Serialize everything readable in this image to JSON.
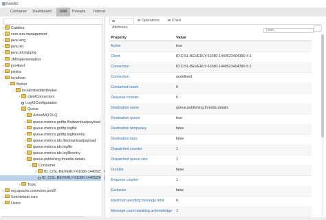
{
  "app": {
    "logo_text": "hawtio"
  },
  "nav": {
    "tabs": [
      "Container",
      "Dashboard",
      "JMX",
      "Threads",
      "Tomcat"
    ],
    "active": "JMX"
  },
  "tree": [
    {
      "label": "Catalina",
      "depth": 0,
      "toggle": "+",
      "icon": "folder"
    },
    {
      "label": "com.sun.management",
      "depth": 0,
      "toggle": "+",
      "icon": "folder"
    },
    {
      "label": "java.lang",
      "depth": 0,
      "toggle": "+",
      "icon": "folder"
    },
    {
      "label": "java.nio",
      "depth": 0,
      "toggle": "+",
      "icon": "folder"
    },
    {
      "label": "java.util.logging",
      "depth": 0,
      "toggle": "+",
      "icon": "folder"
    },
    {
      "label": "JMImplementation",
      "depth": 0,
      "toggle": "+",
      "icon": "folder"
    },
    {
      "label": "jmx4perl",
      "depth": 0,
      "toggle": "+",
      "icon": "folder"
    },
    {
      "label": "jolokia",
      "depth": 0,
      "toggle": "+",
      "icon": "folder"
    },
    {
      "label": "localhost",
      "depth": 0,
      "toggle": "−",
      "icon": "folder"
    },
    {
      "label": "Broker",
      "depth": 1,
      "toggle": "−",
      "icon": "folder"
    },
    {
      "label": "localembeddedbroker",
      "depth": 2,
      "toggle": "−",
      "icon": "folder"
    },
    {
      "label": "clientConnectors",
      "depth": 3,
      "toggle": "+",
      "icon": "folder"
    },
    {
      "label": "Log4JConfiguration",
      "depth": 3,
      "toggle": "",
      "icon": "gear"
    },
    {
      "label": "Queue",
      "depth": 3,
      "toggle": "−",
      "icon": "folder"
    },
    {
      "label": "ActiveMQ.DLQ",
      "depth": 4,
      "toggle": "+",
      "icon": "folder"
    },
    {
      "label": "queue.metrics.grdftp.filedownloadpayload",
      "depth": 4,
      "toggle": "+",
      "icon": "folder"
    },
    {
      "label": "queue.metrics.grdftp.logfile",
      "depth": 4,
      "toggle": "+",
      "icon": "folder"
    },
    {
      "label": "queue.metrics.grdftp.logfileentry",
      "depth": 4,
      "toggle": "+",
      "icon": "folder"
    },
    {
      "label": "queue.metrics.tds.filedownloadpayload",
      "depth": 4,
      "toggle": "+",
      "icon": "folder"
    },
    {
      "label": "queue.metrics.tds.logfile",
      "depth": 4,
      "toggle": "+",
      "icon": "folder"
    },
    {
      "label": "queue.metrics.tds.logfileentry",
      "depth": 4,
      "toggle": "+",
      "icon": "folder"
    },
    {
      "label": "queue.publishing.thredds.details",
      "depth": 4,
      "toggle": "−",
      "icon": "folder"
    },
    {
      "label": "Consumer",
      "depth": 5,
      "toggle": "−",
      "icon": "folder"
    },
    {
      "label": "ID_CISL-BEVERLY-61080-1440523404390-4:1",
      "depth": 6,
      "toggle": "+",
      "icon": "folder"
    },
    {
      "label": "ID_CISL-BEVERLY-61080-1440523404390-",
      "depth": 6,
      "toggle": "",
      "icon": "gear",
      "selected": true
    },
    {
      "label": "Topic",
      "depth": 3,
      "toggle": "+",
      "icon": "folder"
    },
    {
      "label": "org.apache.commons.pool2",
      "depth": 0,
      "toggle": "+",
      "icon": "folder"
    },
    {
      "label": "Solr/default-core",
      "depth": 0,
      "toggle": "+",
      "icon": "folder"
    },
    {
      "label": "Users",
      "depth": 0,
      "toggle": "+",
      "icon": "folder"
    }
  ],
  "subtabs": [
    {
      "label": "Attributes",
      "active": true
    },
    {
      "label": "Operations",
      "active": false
    },
    {
      "label": "Chart",
      "active": false
    }
  ],
  "filter": {
    "placeholder": "Filter..."
  },
  "table": {
    "headers": [
      "Property",
      "Value"
    ],
    "rows": [
      [
        "Active",
        "true"
      ],
      [
        "Client",
        "ID:CISL-BEVERLY-61080-1440523404390-4:1"
      ],
      [
        "Connection",
        "ID:CISL-BEVERLY-61080-1440523404390-5:1"
      ],
      [
        "Connection",
        "undefined"
      ],
      [
        "Consumed count",
        "0"
      ],
      [
        "Dequeue counter",
        "0"
      ],
      [
        "Destination name",
        "queue.publishing.thredds.details"
      ],
      [
        "Destination queue",
        "true"
      ],
      [
        "Destination temporary",
        "false"
      ],
      [
        "Destination topic",
        "false"
      ],
      [
        "Dispatched counter",
        "1"
      ],
      [
        "Dispatched queue size",
        "1"
      ],
      [
        "Durable",
        "false"
      ],
      [
        "Enqueue counter",
        "1"
      ],
      [
        "Exclusive",
        "false"
      ],
      [
        "Maximum pending message limit",
        "0"
      ],
      [
        "Message count awaiting acknowledge",
        "1"
      ]
    ]
  }
}
